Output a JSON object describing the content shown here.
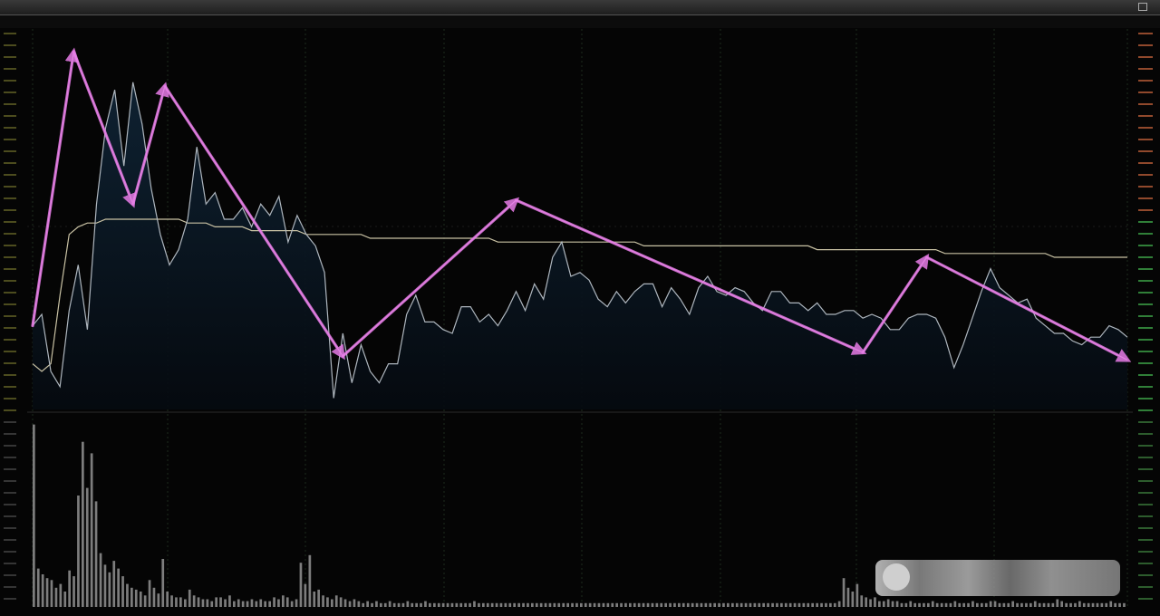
{
  "window": {
    "title": "",
    "subtitle": ""
  },
  "colors": {
    "background": "#050505",
    "price_line": "#aeb6be",
    "average_line": "#c9c2a4",
    "area_fill": "#0b1a26",
    "volume_bar": "#7d7d7d",
    "annotation": "#e67be6",
    "grid": "#1d2a1d",
    "left_axis": "#6b6b2a",
    "right_axis_upper": "#c0603a",
    "right_axis_lower": "#3fa84a"
  },
  "chart_data": [
    {
      "type": "line",
      "title": "",
      "xlabel": "",
      "ylabel": "",
      "grid": true,
      "x": [
        0,
        2,
        4,
        6,
        8,
        10,
        12,
        14,
        16,
        18,
        20,
        22,
        24,
        26,
        28,
        30,
        32,
        34,
        36,
        38,
        40,
        42,
        44,
        46,
        48,
        50,
        52,
        54,
        56,
        58,
        60,
        62,
        64,
        66,
        68,
        70,
        72,
        74,
        76,
        78,
        80,
        82,
        84,
        86,
        88,
        90,
        92,
        94,
        96,
        98,
        100,
        102,
        104,
        106,
        108,
        110,
        112,
        114,
        116,
        118,
        120,
        122,
        124,
        126,
        128,
        130,
        132,
        134,
        136,
        138,
        140,
        142,
        144,
        146,
        148,
        150,
        152,
        154,
        156,
        158,
        160,
        162,
        164,
        166,
        168,
        170,
        172,
        174,
        176,
        178,
        180,
        182,
        184,
        186,
        188,
        190,
        192,
        194,
        196,
        198,
        200,
        202,
        204,
        206,
        208,
        210,
        212,
        214,
        216,
        218,
        220,
        222,
        224,
        226,
        228,
        230,
        232,
        234,
        236,
        238,
        240
      ],
      "series": [
        {
          "values": [
            0.22,
            0.25,
            0.1,
            0.06,
            0.26,
            0.38,
            0.21,
            0.54,
            0.74,
            0.84,
            0.64,
            0.86,
            0.75,
            0.58,
            0.46,
            0.38,
            0.42,
            0.5,
            0.69,
            0.54,
            0.57,
            0.5,
            0.5,
            0.53,
            0.48,
            0.54,
            0.51,
            0.56,
            0.44,
            0.51,
            0.46,
            0.43,
            0.36,
            0.03,
            0.2,
            0.07,
            0.17,
            0.1,
            0.07,
            0.12,
            0.12,
            0.25,
            0.3,
            0.23,
            0.23,
            0.21,
            0.2,
            0.27,
            0.27,
            0.23,
            0.25,
            0.22,
            0.26,
            0.31,
            0.26,
            0.33,
            0.29,
            0.4,
            0.44,
            0.35,
            0.36,
            0.34,
            0.29,
            0.27,
            0.31,
            0.28,
            0.31,
            0.33,
            0.33,
            0.27,
            0.32,
            0.29,
            0.25,
            0.32,
            0.35,
            0.31,
            0.3,
            0.32,
            0.31,
            0.28,
            0.26,
            0.31,
            0.31,
            0.28,
            0.28,
            0.26,
            0.28,
            0.25,
            0.25,
            0.26,
            0.26,
            0.24,
            0.25,
            0.24,
            0.21,
            0.21,
            0.24,
            0.25,
            0.25,
            0.24,
            0.19,
            0.11,
            0.17,
            0.24,
            0.31,
            0.37,
            0.32,
            0.3,
            0.28,
            0.29,
            0.24,
            0.22,
            0.2,
            0.2,
            0.18,
            0.17,
            0.19,
            0.19,
            0.22,
            0.21,
            0.19
          ]
        },
        {
          "values": [
            0.12,
            0.1,
            0.12,
            0.3,
            0.46,
            0.48,
            0.49,
            0.49,
            0.5,
            0.5,
            0.5,
            0.5,
            0.5,
            0.5,
            0.5,
            0.5,
            0.5,
            0.49,
            0.49,
            0.49,
            0.48,
            0.48,
            0.48,
            0.48,
            0.47,
            0.47,
            0.47,
            0.47,
            0.47,
            0.47,
            0.46,
            0.46,
            0.46,
            0.46,
            0.46,
            0.46,
            0.46,
            0.45,
            0.45,
            0.45,
            0.45,
            0.45,
            0.45,
            0.45,
            0.45,
            0.45,
            0.45,
            0.45,
            0.45,
            0.45,
            0.45,
            0.44,
            0.44,
            0.44,
            0.44,
            0.44,
            0.44,
            0.44,
            0.44,
            0.44,
            0.44,
            0.44,
            0.44,
            0.44,
            0.44,
            0.44,
            0.44,
            0.43,
            0.43,
            0.43,
            0.43,
            0.43,
            0.43,
            0.43,
            0.43,
            0.43,
            0.43,
            0.43,
            0.43,
            0.43,
            0.43,
            0.43,
            0.43,
            0.43,
            0.43,
            0.43,
            0.42,
            0.42,
            0.42,
            0.42,
            0.42,
            0.42,
            0.42,
            0.42,
            0.42,
            0.42,
            0.42,
            0.42,
            0.42,
            0.42,
            0.41,
            0.41,
            0.41,
            0.41,
            0.41,
            0.41,
            0.41,
            0.41,
            0.41,
            0.41,
            0.41,
            0.41,
            0.4,
            0.4,
            0.4,
            0.4,
            0.4,
            0.4,
            0.4,
            0.4,
            0.4
          ]
        }
      ],
      "annotations": [
        {
          "type": "trendline",
          "from": [
            0,
            0.22
          ],
          "to": [
            9,
            0.94
          ]
        },
        {
          "type": "trendline",
          "from": [
            9,
            0.94
          ],
          "to": [
            22,
            0.54
          ]
        },
        {
          "type": "trendline",
          "from": [
            22,
            0.54
          ],
          "to": [
            29,
            0.85
          ]
        },
        {
          "type": "trendline",
          "from": [
            29,
            0.85
          ],
          "to": [
            68,
            0.14
          ]
        },
        {
          "type": "trendline",
          "from": [
            68,
            0.14
          ],
          "to": [
            106,
            0.55
          ]
        },
        {
          "type": "trendline",
          "from": [
            106,
            0.55
          ],
          "to": [
            182,
            0.15
          ]
        },
        {
          "type": "trendline",
          "from": [
            182,
            0.15
          ],
          "to": [
            196,
            0.4
          ]
        },
        {
          "type": "trendline",
          "from": [
            196,
            0.4
          ],
          "to": [
            240,
            0.13
          ]
        }
      ]
    },
    {
      "type": "bar",
      "title": "",
      "series": [
        {
          "values": [
            0.95,
            0.2,
            0.17,
            0.15,
            0.14,
            0.1,
            0.12,
            0.08,
            0.19,
            0.16,
            0.58,
            0.86,
            0.62,
            0.8,
            0.55,
            0.28,
            0.22,
            0.18,
            0.24,
            0.2,
            0.16,
            0.12,
            0.1,
            0.09,
            0.08,
            0.06,
            0.14,
            0.1,
            0.07,
            0.25,
            0.08,
            0.06,
            0.05,
            0.05,
            0.04,
            0.09,
            0.06,
            0.05,
            0.04,
            0.04,
            0.03,
            0.05,
            0.05,
            0.04,
            0.06,
            0.03,
            0.04,
            0.03,
            0.03,
            0.04,
            0.03,
            0.04,
            0.03,
            0.03,
            0.05,
            0.04,
            0.06,
            0.05,
            0.03,
            0.04,
            0.23,
            0.12,
            0.27,
            0.08,
            0.09,
            0.06,
            0.05,
            0.04,
            0.06,
            0.05,
            0.04,
            0.03,
            0.04,
            0.03,
            0.02,
            0.03,
            0.02,
            0.03,
            0.02,
            0.02,
            0.03,
            0.02,
            0.02,
            0.02,
            0.03,
            0.02,
            0.02,
            0.02,
            0.03,
            0.02,
            0.02,
            0.02,
            0.02,
            0.02,
            0.02,
            0.02,
            0.02,
            0.02,
            0.02,
            0.03,
            0.02,
            0.02,
            0.02,
            0.02,
            0.02,
            0.02,
            0.02,
            0.02,
            0.02,
            0.02,
            0.02,
            0.02,
            0.02,
            0.02,
            0.02,
            0.02,
            0.02,
            0.02,
            0.02,
            0.02,
            0.02,
            0.02,
            0.02,
            0.02,
            0.02,
            0.02,
            0.02,
            0.02,
            0.02,
            0.02,
            0.02,
            0.02,
            0.02,
            0.02,
            0.02,
            0.02,
            0.02,
            0.02,
            0.02,
            0.02,
            0.02,
            0.02,
            0.02,
            0.02,
            0.02,
            0.02,
            0.02,
            0.02,
            0.02,
            0.02,
            0.02,
            0.02,
            0.02,
            0.02,
            0.02,
            0.02,
            0.02,
            0.02,
            0.02,
            0.02,
            0.02,
            0.02,
            0.02,
            0.02,
            0.02,
            0.02,
            0.02,
            0.02,
            0.02,
            0.02,
            0.02,
            0.02,
            0.02,
            0.02,
            0.02,
            0.02,
            0.02,
            0.02,
            0.02,
            0.02,
            0.02,
            0.03,
            0.15,
            0.1,
            0.08,
            0.12,
            0.06,
            0.05,
            0.04,
            0.05,
            0.03,
            0.03,
            0.04,
            0.03,
            0.03,
            0.02,
            0.02,
            0.03,
            0.02,
            0.02,
            0.02,
            0.02,
            0.03,
            0.02,
            0.02,
            0.02,
            0.02,
            0.03,
            0.02,
            0.02,
            0.02,
            0.03,
            0.02,
            0.02,
            0.02,
            0.03,
            0.03,
            0.02,
            0.02,
            0.02,
            0.03,
            0.02,
            0.02,
            0.02,
            0.02,
            0.03,
            0.02,
            0.02,
            0.02,
            0.02,
            0.04,
            0.03,
            0.02,
            0.02,
            0.02,
            0.03,
            0.02,
            0.02,
            0.02,
            0.02,
            0.02,
            0.02,
            0.03,
            0.02,
            0.02,
            0.02
          ]
        }
      ]
    }
  ]
}
